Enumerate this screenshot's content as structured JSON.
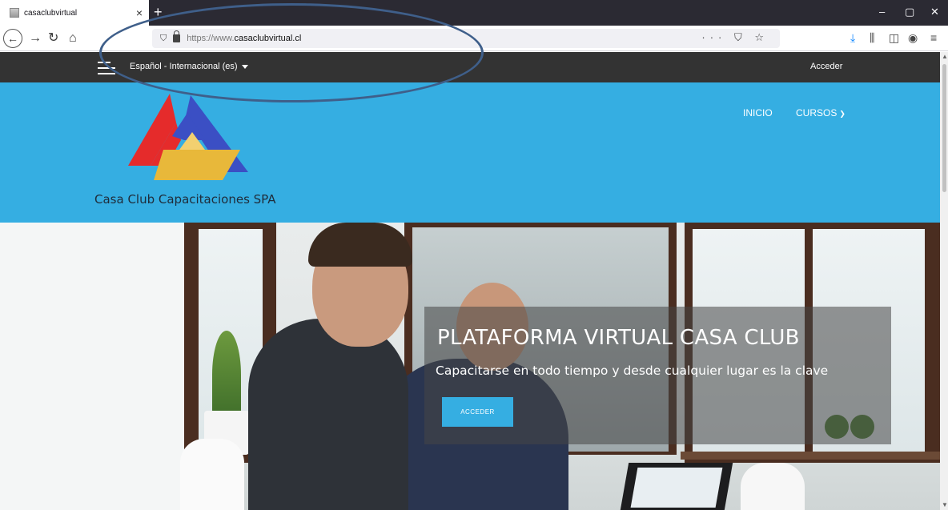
{
  "browser": {
    "tab_title": "casaclubvirtual",
    "tab_close": "×",
    "new_tab": "+",
    "url_protocol": "https://www.",
    "url_domain": "casaclubvirtual.cl",
    "url_actions": "··· ⛉ ☆",
    "window_controls": [
      "–",
      "▢",
      "✕"
    ]
  },
  "site": {
    "language_selector": "Español - Internacional (es)",
    "login_link": "Acceder",
    "brand_name": "Casa Club Capacitaciones SPA",
    "menu": [
      {
        "label": "INICIO"
      },
      {
        "label": "CURSOS"
      }
    ],
    "hero": {
      "title": "PLATAFORMA VIRTUAL CASA CLUB",
      "subtitle": "Capacitarse en todo tiempo y desde cualquier lugar es la clave",
      "button_label": "ACCEDER"
    }
  },
  "colors": {
    "accent_blue": "#35aee2",
    "topbar": "#333333",
    "logo_red": "#e52b2b",
    "logo_blue": "#3b4fc4",
    "logo_gold": "#e8b83a",
    "annotation": "#3f5f8a"
  }
}
